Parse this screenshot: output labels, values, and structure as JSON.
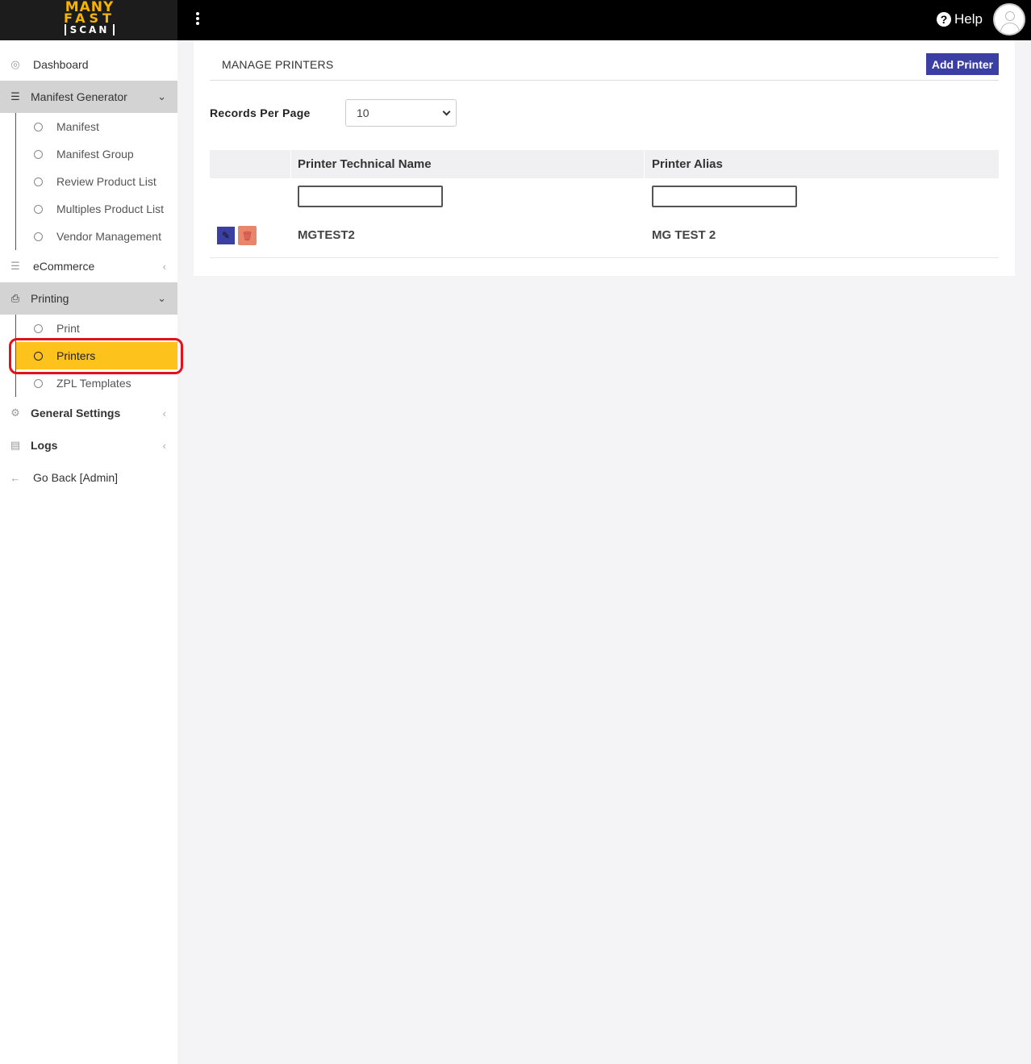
{
  "brand": {
    "line1": "MANY",
    "line2": "FAST",
    "line3": "SCAN"
  },
  "topbar": {
    "help_label": "Help"
  },
  "sidebar": {
    "dashboard": "Dashboard",
    "manifest_generator": {
      "label": "Manifest Generator",
      "items": [
        "Manifest",
        "Manifest Group",
        "Review Product List",
        "Multiples Product List",
        "Vendor Management"
      ]
    },
    "ecommerce": "eCommerce",
    "printing": {
      "label": "Printing",
      "items": [
        "Print",
        "Printers",
        "ZPL Templates"
      ],
      "active": "Printers"
    },
    "general_settings": "General Settings",
    "logs": "Logs",
    "go_back": "Go Back [Admin]"
  },
  "main": {
    "title": "MANAGE PRINTERS",
    "add_button": "Add Printer",
    "records_per_page_label": "Records Per Page",
    "records_per_page_value": "10",
    "columns": [
      "Printer Technical Name",
      "Printer Alias"
    ],
    "rows": [
      {
        "technical_name": "MGTEST2",
        "alias": "MG TEST 2"
      }
    ]
  },
  "colors": {
    "accent": "#3b3fa3",
    "active_nav": "#fdc21c",
    "delete": "#e8866b",
    "annotation": "#e0121b"
  }
}
